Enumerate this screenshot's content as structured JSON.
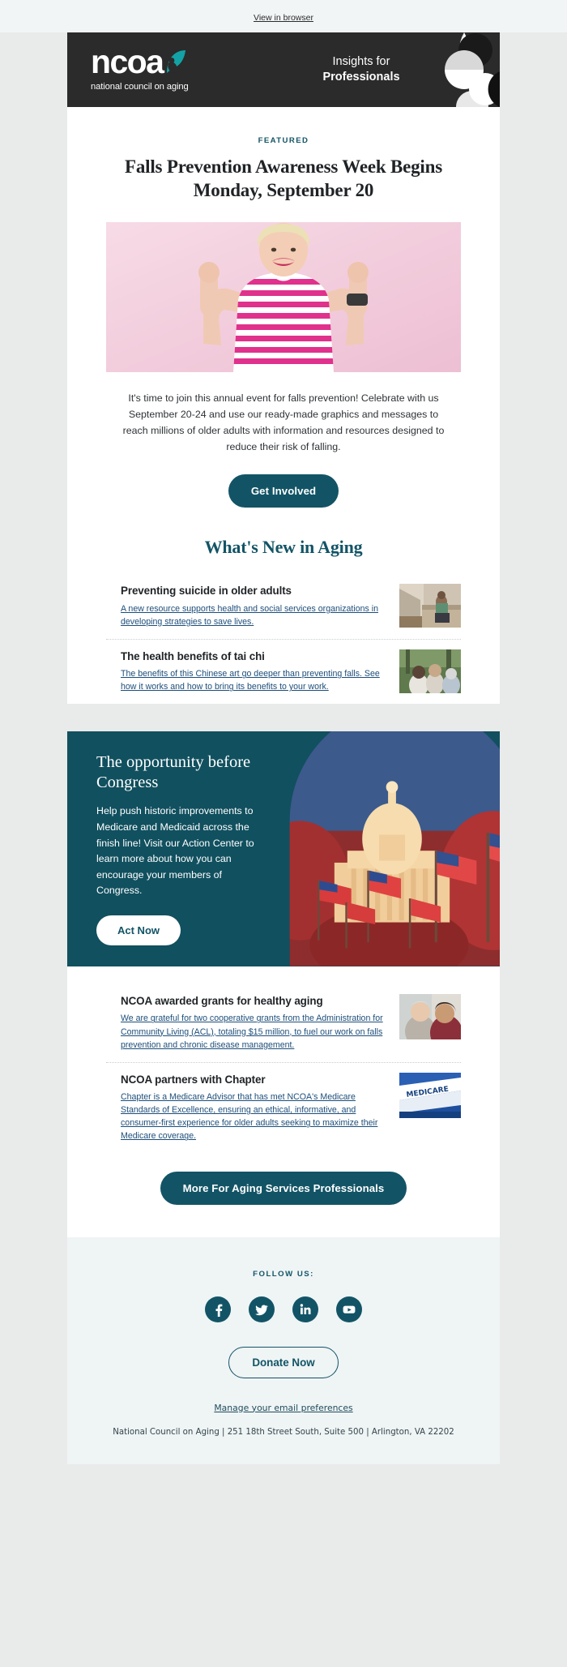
{
  "preheader": {
    "view_in_browser": "View in browser"
  },
  "header": {
    "logo_word": "ncoa",
    "logo_tagline": "national council on aging",
    "eyebrow_line1": "Insights for",
    "eyebrow_line2": "Professionals",
    "background": "#2b2b2b",
    "accent": "#13a3a6"
  },
  "featured": {
    "label": "FEATURED",
    "title": "Falls Prevention Awareness Week Begins Monday, September 20",
    "hero_alt": "older-woman-flexing-arms-pink-background",
    "intro": "It's time to join this annual event for falls prevention! Celebrate with us September 20-24 and use our ready-made graphics and messages to reach millions of older adults with information and resources designed to reduce their risk of falling.",
    "cta_label": "Get Involved"
  },
  "whats_new": {
    "heading": "What's New in Aging",
    "articles": [
      {
        "title": "Preventing suicide in older adults",
        "description": "A new resource supports health and social services organizations in developing strategies to save lives.",
        "thumb_alt": "older-man-sitting-on-couch"
      },
      {
        "title": "The health benefits of tai chi",
        "description": "The benefits of this Chinese art go deeper than preventing falls. See how it works and how to bring its benefits to your work.",
        "thumb_alt": "people-practicing-tai-chi-outdoors"
      }
    ]
  },
  "congress": {
    "title": "The opportunity before Congress",
    "body": "Help push historic improvements to Medicare and Medicaid across the finish line! Visit our Action Center to learn more about how you can encourage your members of Congress.",
    "cta_label": "Act Now",
    "image_alt": "us-capitol-building-with-american-flags",
    "background": "#11505f"
  },
  "more_articles": {
    "articles": [
      {
        "title": "NCOA awarded grants for healthy aging",
        "description": "We are grateful for two cooperative grants from the Administration for Community Living (ACL), totaling $15 million, to fuel our work on falls prevention and chronic disease management.",
        "thumb_alt": "two-women-embracing"
      },
      {
        "title": "NCOA partners with Chapter",
        "description": "Chapter is a Medicare Advisor that has met NCOA's Medicare Standards of Excellence, ensuring an ethical, informative, and consumer-first experience for older adults seeking to maximize their Medicare coverage.",
        "thumb_alt": "medicare-card"
      }
    ],
    "cta_label": "More For Aging Services Professionals"
  },
  "footer": {
    "follow_label": "FOLLOW US:",
    "socials": [
      {
        "name": "facebook",
        "label": "Facebook"
      },
      {
        "name": "twitter",
        "label": "Twitter"
      },
      {
        "name": "linkedin",
        "label": "LinkedIn"
      },
      {
        "name": "youtube",
        "label": "YouTube"
      }
    ],
    "donate_label": "Donate Now",
    "preferences_label": "Manage your email preferences",
    "address": "National Council on Aging | 251 18th Street South, Suite 500 | Arlington, VA 22202"
  },
  "colors": {
    "teal": "#125466",
    "dark": "#2b2b2b",
    "link": "#1d4e7a",
    "page_bg": "#e9eaea",
    "footer_bg": "#eff4f5"
  }
}
